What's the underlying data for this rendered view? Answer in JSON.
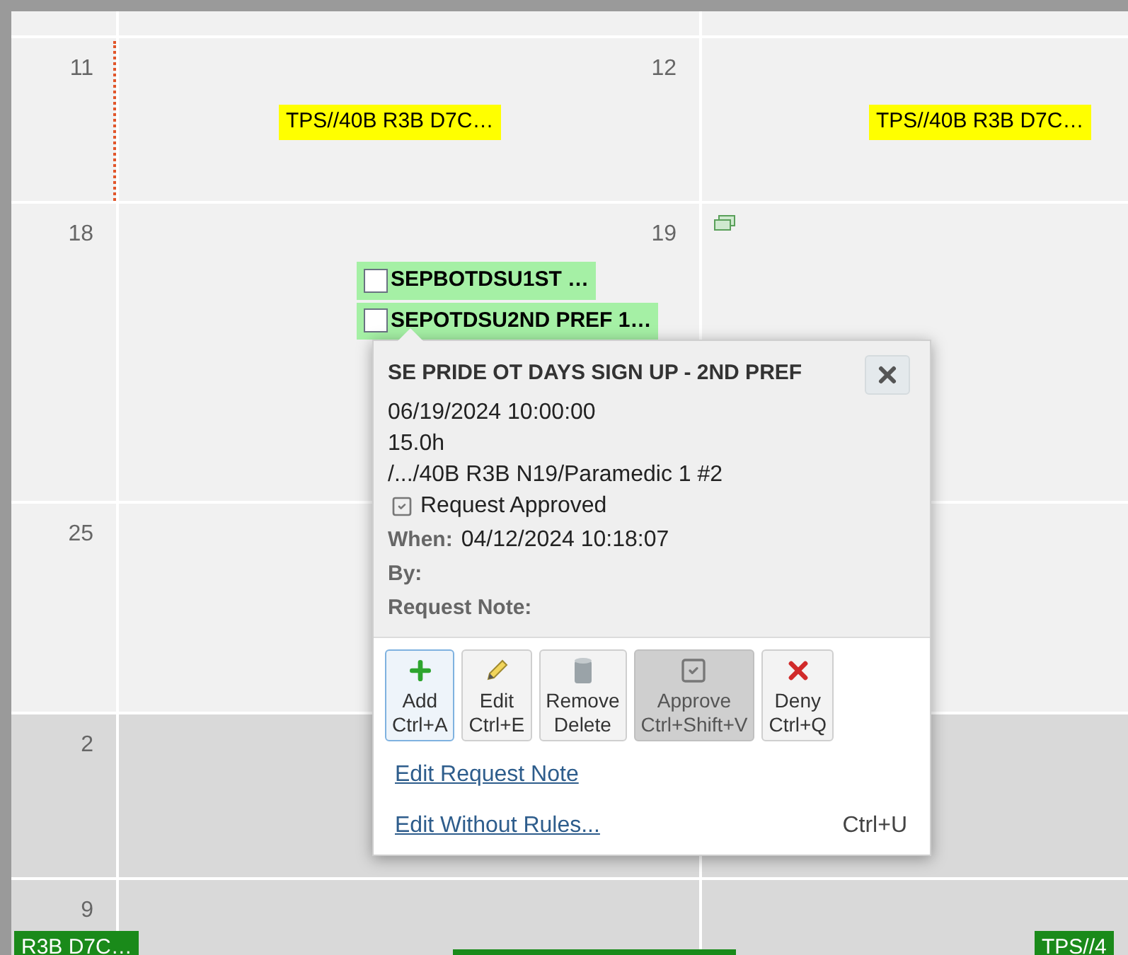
{
  "calendar": {
    "weeks": [
      {
        "shaded": false
      },
      {
        "shaded": false,
        "days": [
          {
            "number": "11",
            "today_line": true
          },
          {
            "number": "12",
            "events": [
              {
                "kind": "tag",
                "label": "TPS//40B R3B D7C…",
                "color": "#ffff00"
              }
            ]
          },
          {
            "events": [
              {
                "kind": "tag",
                "label": "TPS//40B R3B D7C…",
                "color": "#ffff00"
              }
            ]
          }
        ]
      },
      {
        "shaded": false,
        "days": [
          {
            "number": "18"
          },
          {
            "number": "19",
            "events": [
              {
                "kind": "check",
                "label": "SEPBOTDSU1ST …",
                "checked": false,
                "color": "#a5f0a5"
              },
              {
                "kind": "check",
                "label": "SEPOTDSU2ND PREF 1…",
                "checked": false,
                "color": "#a5f0a5"
              }
            ]
          },
          {
            "note_icon": true
          }
        ]
      },
      {
        "shaded": false,
        "days": [
          {
            "number": "25"
          }
        ]
      },
      {
        "shaded": true,
        "days": [
          {
            "number": "2"
          }
        ]
      },
      {
        "shaded": true,
        "days": [
          {
            "number": "9",
            "events": [
              {
                "kind": "tag",
                "label": "R3B D7C…",
                "color": "#1a8a1a"
              }
            ]
          },
          {
            "events": [
              {
                "kind": "bar",
                "color": "#1a8a1a"
              }
            ]
          },
          {
            "events": [
              {
                "kind": "tag",
                "label": "TPS//4",
                "color": "#1a8a1a"
              }
            ]
          }
        ]
      }
    ]
  },
  "popup": {
    "title": "SE PRIDE OT DAYS SIGN UP - 2ND PREF",
    "lines": [
      "06/19/2024 10:00:00",
      "15.0h",
      "/.../40B R3B N19/Paramedic 1 #2"
    ],
    "status": "Request Approved",
    "fields": [
      {
        "label": "When:",
        "value": "04/12/2024 10:18:07"
      },
      {
        "label": "By:"
      },
      {
        "label": "Request Note:"
      }
    ],
    "buttons": [
      {
        "kind": "add",
        "label": "Add",
        "shortcut": "Ctrl+A",
        "focused": true,
        "pressed": false
      },
      {
        "kind": "edit",
        "label": "Edit",
        "shortcut": "Ctrl+E",
        "focused": false,
        "pressed": false
      },
      {
        "kind": "remove",
        "label": "Remove",
        "shortcut": "Delete",
        "focused": false,
        "pressed": false
      },
      {
        "kind": "approve",
        "label": "Approve",
        "shortcut": "Ctrl+Shift+V",
        "focused": false,
        "pressed": true
      },
      {
        "kind": "deny",
        "label": "Deny",
        "shortcut": "Ctrl+Q",
        "focused": false,
        "pressed": false
      }
    ],
    "links": [
      {
        "label": "Edit Request Note"
      },
      {
        "label": "Edit Without Rules...",
        "shortcut": "Ctrl+U"
      }
    ]
  }
}
